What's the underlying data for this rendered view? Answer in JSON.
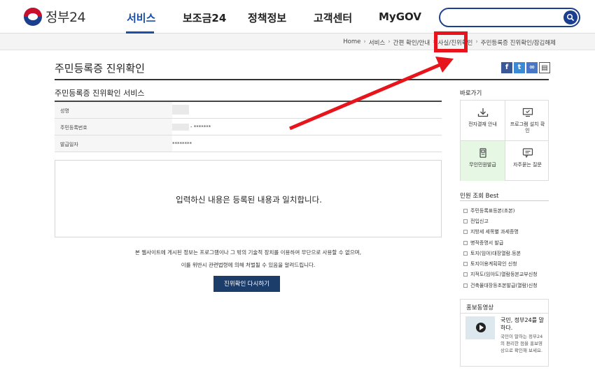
{
  "header": {
    "logo_text": "정부24",
    "nav": [
      {
        "label": "서비스",
        "active": true
      },
      {
        "label": "보조금24",
        "active": false
      },
      {
        "label": "정책정보",
        "active": false
      },
      {
        "label": "고객센터",
        "active": false
      },
      {
        "label": "MyGOV",
        "active": false
      }
    ],
    "search_placeholder": ""
  },
  "breadcrumb": [
    "Home",
    "서비스",
    "간편 확인/안내",
    "사실/진위확인",
    "주민등록증 진위확인/잠김해제"
  ],
  "page": {
    "title": "주민등록증 진위확인",
    "service_title": "주민등록증 진위확인 서비스",
    "fields": [
      {
        "label": "성명",
        "value": ""
      },
      {
        "label": "주민등록번호",
        "value": "- *******"
      },
      {
        "label": "발급일자",
        "value": "********"
      }
    ],
    "result": "입력하신 내용은 등록된 내용과 일치합니다.",
    "notice_line1": "본 웹사이트에 게시된 정보는 프로그램이나 그 밖의 기술적 장치를 이용하여 무단으로 사용할 수 없으며,",
    "notice_line2": "이를 위반시 관련법령에 의해 처벌될 수 있음을 알려드립니다.",
    "retry_label": "진위확인 다시하기"
  },
  "share_icons": [
    "facebook-icon",
    "twitter-icon",
    "link-icon",
    "print-icon"
  ],
  "sidebar": {
    "quick_title": "바로가기",
    "quick_links": [
      {
        "label": "전자결재 안내",
        "icon": "download-icon"
      },
      {
        "label": "프로그램 설치 확인",
        "icon": "monitor-icon"
      },
      {
        "label": "무인민원발급",
        "icon": "kiosk-icon"
      },
      {
        "label": "자주묻는 질문",
        "icon": "chat-icon"
      }
    ],
    "best_title": "민원 조회 Best",
    "best_items": [
      "주민등록표등본(초본)",
      "전입신고",
      "지방세 세목별 과세증명",
      "병적증명서 발급",
      "토지(임야)대장열람.등본",
      "토지이용계획확인 신청",
      "지적도(임야도)열람등본교부신청",
      "건축물대장등초본발급(열람)신청"
    ],
    "promo_title": "홍보동영상",
    "promo_heading": "국민, 정부24를 말하다.",
    "promo_desc": "국민이 말하는 정부24의 편리한 점을 홍보영상으로 확인해 보세요."
  },
  "colors": {
    "brand_blue": "#1b4ea8",
    "navy_button": "#1c3c6a",
    "highlight_green": "#e6f7e4",
    "annotation_red": "#e8141b"
  }
}
